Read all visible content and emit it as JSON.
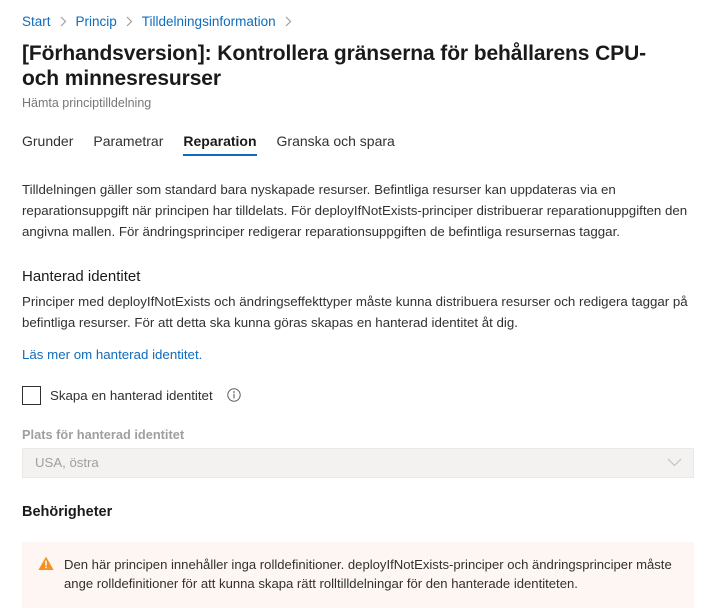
{
  "breadcrumb": {
    "items": [
      {
        "label": "Start"
      },
      {
        "label": "Princip"
      },
      {
        "label": "Tilldelningsinformation"
      }
    ],
    "separator_icon": "chevron-right-icon"
  },
  "header": {
    "title": "[Förhandsversion]: Kontrollera gränserna för behållarens CPU- och minnesresurser",
    "subtitle": "Hämta principtilldelning"
  },
  "tabs": [
    {
      "label": "Grunder",
      "active": false
    },
    {
      "label": "Parametrar",
      "active": false
    },
    {
      "label": "Reparation",
      "active": true
    },
    {
      "label": "Granska och spara",
      "active": false
    }
  ],
  "main": {
    "intro": "Tilldelningen gäller som standard bara nyskapade resurser. Befintliga resurser kan uppdateras via en reparationsuppgift när principen har tilldelats. För deployIfNotExists-principer distribuerar reparationuppgiften den angivna mallen. För ändringsprinciper redigerar reparationsuppgiften de befintliga resursernas taggar.",
    "managed_identity": {
      "heading": "Hanterad identitet",
      "description": "Principer med deployIfNotExists och ändringseffekttyper måste kunna distribuera resurser och redigera taggar på befintliga resurser. För att detta ska kunna göras skapas en hanterad identitet åt dig.",
      "link_text": "Läs mer om hanterad identitet.",
      "checkbox": {
        "label": "Skapa en hanterad identitet",
        "checked": false,
        "info_icon": "info-circle-icon"
      },
      "location_field": {
        "label": "Plats för hanterad identitet",
        "value": "USA, östra",
        "disabled": true,
        "chevron_icon": "chevron-down-icon"
      }
    },
    "permissions": {
      "heading": "Behörigheter",
      "warning": {
        "icon": "warning-triangle-icon",
        "text": "Den här principen innehåller inga rolldefinitioner. deployIfNotExists-principer och ändringsprinciper måste ange rolldefinitioner för att kunna skapa rätt rolltilldelningar för den hanterade identiteten."
      }
    }
  },
  "colors": {
    "accent": "#0f6cbd",
    "link": "#0f6cbd",
    "warning_icon": "#f7901e",
    "warning_bg": "#fdf6f2",
    "text": "#323130",
    "muted": "#a19f9d"
  }
}
